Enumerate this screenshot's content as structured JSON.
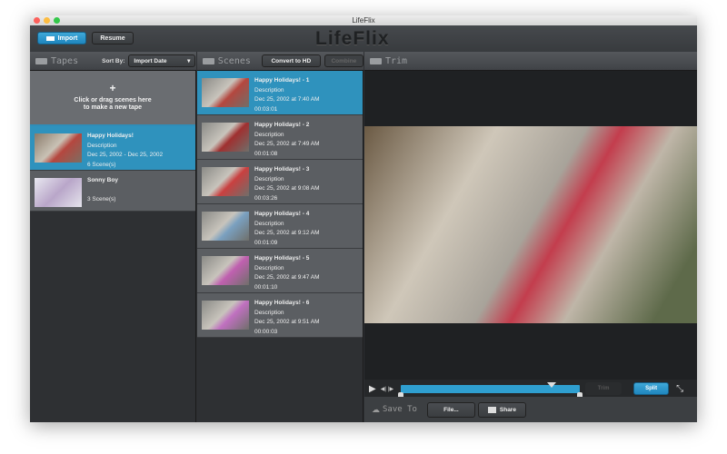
{
  "window": {
    "title": "LifeFlix"
  },
  "toolbar": {
    "import_label": "Import",
    "resume_label": "Resume",
    "logo": "LifeFlix"
  },
  "tapes": {
    "title": "Tapes",
    "sort_label": "Sort By:",
    "sort_value": "Import Date",
    "new_tape_plus": "+",
    "new_tape_text1": "Click or drag scenes here",
    "new_tape_text2": "to make a new tape",
    "items": [
      {
        "title": "Happy Holidays!",
        "description": "Description",
        "dates": "Dec 25, 2002 - Dec 25, 2002",
        "scenes": "6 Scene(s)"
      },
      {
        "title": "Sonny Boy",
        "scenes": "3 Scene(s)"
      }
    ]
  },
  "scenes": {
    "title": "Scenes",
    "convert_label": "Convert to HD",
    "combine_label": "Combine",
    "items": [
      {
        "title": "Happy Holidays! - 1",
        "description": "Description",
        "date": "Dec 25, 2002 at 7:40 AM",
        "duration": "00:03:01"
      },
      {
        "title": "Happy Holidays! - 2",
        "description": "Description",
        "date": "Dec 25, 2002 at 7:49 AM",
        "duration": "00:01:08"
      },
      {
        "title": "Happy Holidays! - 3",
        "description": "Description",
        "date": "Dec 25, 2002 at 9:08 AM",
        "duration": "00:03:26"
      },
      {
        "title": "Happy Holidays! - 4",
        "description": "Description",
        "date": "Dec 25, 2002 at 9:12 AM",
        "duration": "00:01:09"
      },
      {
        "title": "Happy Holidays! - 5",
        "description": "Description",
        "date": "Dec 25, 2002 at 9:47 AM",
        "duration": "00:01:10"
      },
      {
        "title": "Happy Holidays! - 6",
        "description": "Description",
        "date": "Dec 25, 2002 at 9:51 AM",
        "duration": "00:00:03"
      }
    ]
  },
  "trim": {
    "title": "Trim",
    "trim_label": "Trim",
    "split_label": "Split",
    "playhead_fraction": 0.84
  },
  "save": {
    "title": "Save To",
    "file_label": "File...",
    "share_label": "Share"
  },
  "colors": {
    "accent": "#2f92bd"
  }
}
